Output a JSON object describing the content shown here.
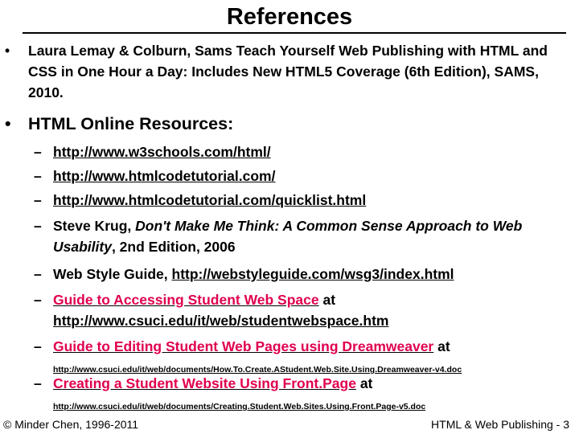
{
  "title": "References",
  "bullet_glyph": "•",
  "dash_glyph": "–",
  "ref1": {
    "text": "Laura Lemay & Colburn, Sams Teach Yourself Web Publishing with HTML and CSS in One Hour a Day: Includes New HTML5 Coverage (6th Edition), SAMS, 2010."
  },
  "ref2": {
    "heading": "HTML Online Resources:",
    "items": {
      "w3schools_url": "http://www.w3schools.com/html/",
      "htmlcodetutorial_url": "http://www.htmlcodetutorial.com/",
      "quicklist_url": "http://www.htmlcodetutorial.com/quicklist.html",
      "krug_author": "Steve Krug, ",
      "krug_title": "Don't Make Me Think: A Common Sense Approach to Web Usability",
      "krug_edition": ", 2nd Edition, 2006",
      "style_guide_label": "Web Style Guide, ",
      "style_guide_url": "http://webstyleguide.com/wsg3/index.html",
      "student_space_link": "Guide to Accessing Student Web Space",
      "student_space_at": " at",
      "student_space_url": "http://www.csuci.edu/it/web/studentwebspace.htm",
      "dreamweaver_link": "Guide to Editing Student Web Pages using Dreamweaver",
      "dreamweaver_at": " at",
      "dreamweaver_url": "http://www.csuci.edu/it/web/documents/How.To.Create.AStudent.Web.Site.Using.Dreamweaver-v4.doc",
      "frontpage_link": "Creating a Student Website Using Front.Page",
      "frontpage_at": " at",
      "frontpage_url": "http://www.csuci.edu/it/web/documents/Creating.Student.Web.Sites.Using.Front.Page-v5.doc"
    }
  },
  "footer": {
    "copyright": "© Minder Chen, 1996-2011",
    "course_page": "HTML & Web Publishing - 3"
  },
  "colors": {
    "link_red": "#e0004f",
    "text": "#000000",
    "background": "#ffffff"
  }
}
